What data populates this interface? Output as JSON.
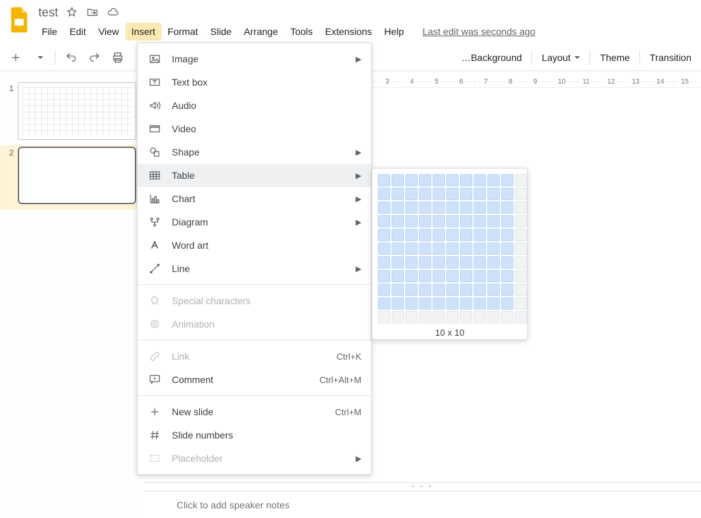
{
  "doc": {
    "title": "test",
    "last_edit": "Last edit was seconds ago"
  },
  "menubar": {
    "items": [
      "File",
      "Edit",
      "View",
      "Insert",
      "Format",
      "Slide",
      "Arrange",
      "Tools",
      "Extensions",
      "Help"
    ],
    "active_index": 3
  },
  "toolbar": {
    "background": "Background",
    "layout": "Layout",
    "theme": "Theme",
    "transition": "Transition"
  },
  "ruler": {
    "start": 3,
    "end": 15
  },
  "filmstrip": {
    "slides": [
      {
        "num": "1",
        "selected": false,
        "has_grid": true
      },
      {
        "num": "2",
        "selected": true,
        "has_grid": false
      }
    ]
  },
  "insert_menu": {
    "groups": [
      [
        {
          "key": "image",
          "label": "Image",
          "icon": "image-icon",
          "submenu": true
        },
        {
          "key": "textbox",
          "label": "Text box",
          "icon": "textbox-icon"
        },
        {
          "key": "audio",
          "label": "Audio",
          "icon": "audio-icon"
        },
        {
          "key": "video",
          "label": "Video",
          "icon": "video-icon"
        },
        {
          "key": "shape",
          "label": "Shape",
          "icon": "shape-icon",
          "submenu": true
        },
        {
          "key": "table",
          "label": "Table",
          "icon": "table-icon",
          "submenu": true,
          "hover": true
        },
        {
          "key": "chart",
          "label": "Chart",
          "icon": "chart-icon",
          "submenu": true
        },
        {
          "key": "diagram",
          "label": "Diagram",
          "icon": "diagram-icon",
          "submenu": true
        },
        {
          "key": "wordart",
          "label": "Word art",
          "icon": "wordart-icon"
        },
        {
          "key": "line",
          "label": "Line",
          "icon": "line-icon",
          "submenu": true
        }
      ],
      [
        {
          "key": "special",
          "label": "Special characters",
          "icon": "omega-icon",
          "disabled": true
        },
        {
          "key": "animation",
          "label": "Animation",
          "icon": "animation-icon",
          "disabled": true
        }
      ],
      [
        {
          "key": "link",
          "label": "Link",
          "icon": "link-icon",
          "shortcut": "Ctrl+K",
          "disabled": true
        },
        {
          "key": "comment",
          "label": "Comment",
          "icon": "comment-icon",
          "shortcut": "Ctrl+Alt+M"
        }
      ],
      [
        {
          "key": "newslide",
          "label": "New slide",
          "icon": "plus-icon",
          "shortcut": "Ctrl+M"
        },
        {
          "key": "slidenums",
          "label": "Slide numbers",
          "icon": "hash-icon"
        },
        {
          "key": "placeholder",
          "label": "Placeholder",
          "icon": "placeholder-icon",
          "submenu": true,
          "disabled": true
        }
      ]
    ]
  },
  "table_picker": {
    "rows": 10,
    "cols": 10,
    "grid": 11,
    "label": "10 x 10"
  },
  "notes": {
    "placeholder": "Click to add speaker notes"
  }
}
